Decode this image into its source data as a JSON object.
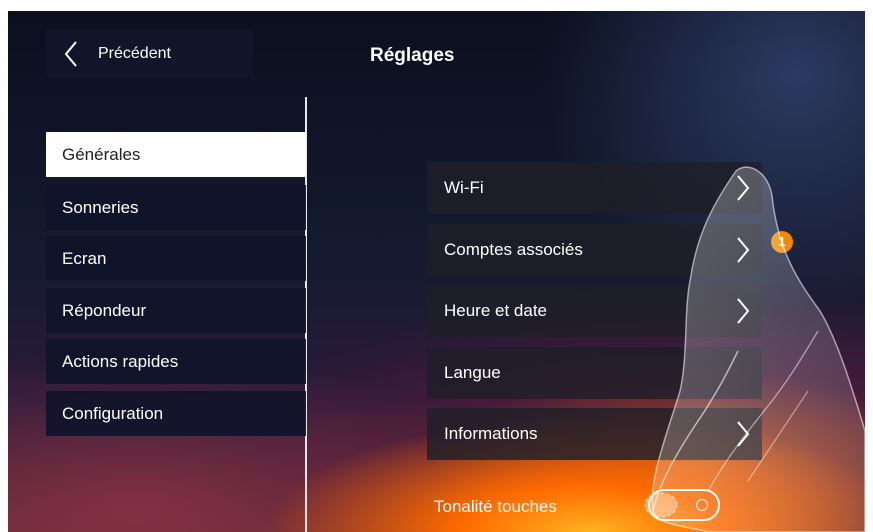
{
  "header": {
    "back_label": "Précédent",
    "title": "Réglages"
  },
  "sidebar": {
    "items": [
      {
        "label": "Générales",
        "active": true
      },
      {
        "label": "Sonneries",
        "active": false
      },
      {
        "label": "Ecran",
        "active": false
      },
      {
        "label": "Répondeur",
        "active": false
      },
      {
        "label": "Actions rapides",
        "active": false
      },
      {
        "label": "Configuration",
        "active": false
      }
    ]
  },
  "main": {
    "items": [
      {
        "label": "Wi-Fi"
      },
      {
        "label": "Comptes associés"
      },
      {
        "label": "Heure et date"
      },
      {
        "label": "Langue"
      },
      {
        "label": "Informations"
      }
    ],
    "toggle": {
      "label": "Tonalité touches",
      "state": "off"
    }
  },
  "callout": {
    "number": "1"
  },
  "colors": {
    "panel": "#12162a",
    "active_item": "#ffffff",
    "badge": "#f08a00",
    "accent_glow": "#ff6a00"
  },
  "icons": [
    "chevron-left-icon",
    "chevron-right-icon",
    "pointing-hand-icon"
  ]
}
